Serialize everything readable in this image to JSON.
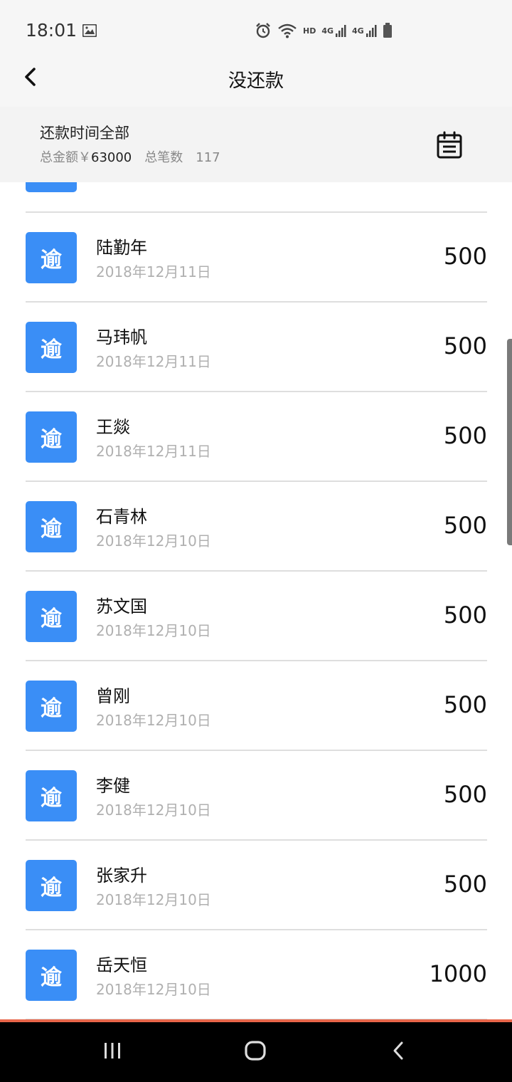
{
  "status_bar": {
    "time": "18:01",
    "hd": "HD",
    "net1": "4G",
    "net2": "4G",
    "icons": [
      "gallery-icon",
      "alarm-icon",
      "wifi-icon",
      "signal-icon",
      "battery-icon"
    ]
  },
  "header": {
    "title": "没还款",
    "back_icon": "back-arrow-icon"
  },
  "summary": {
    "filter_label": "还款时间全部",
    "total_amount_label": "总金额￥",
    "total_amount_value": "63000",
    "total_count_label": "总笔数",
    "total_count_value": "117",
    "calendar_icon": "calendar-icon"
  },
  "list": {
    "items": [
      {
        "badge": "逾",
        "name": "陆勤年",
        "date": "2018年12月11日",
        "amount": "500"
      },
      {
        "badge": "逾",
        "name": "马玮帆",
        "date": "2018年12月11日",
        "amount": "500"
      },
      {
        "badge": "逾",
        "name": "王燚",
        "date": "2018年12月11日",
        "amount": "500"
      },
      {
        "badge": "逾",
        "name": "石青林",
        "date": "2018年12月10日",
        "amount": "500"
      },
      {
        "badge": "逾",
        "name": "苏文国",
        "date": "2018年12月10日",
        "amount": "500"
      },
      {
        "badge": "逾",
        "name": "曾刚",
        "date": "2018年12月10日",
        "amount": "500"
      },
      {
        "badge": "逾",
        "name": "李健",
        "date": "2018年12月10日",
        "amount": "500"
      },
      {
        "badge": "逾",
        "name": "张家升",
        "date": "2018年12月10日",
        "amount": "500"
      },
      {
        "badge": "逾",
        "name": "岳天恒",
        "date": "2018年12月10日",
        "amount": "1000"
      }
    ]
  },
  "colors": {
    "badge_blue": "#3a8ef6",
    "accent_red": "#e8664a",
    "date_gray": "#b0b0b0"
  },
  "nav_bar": {
    "icons": [
      "recent-apps-icon",
      "home-icon",
      "back-icon"
    ]
  }
}
